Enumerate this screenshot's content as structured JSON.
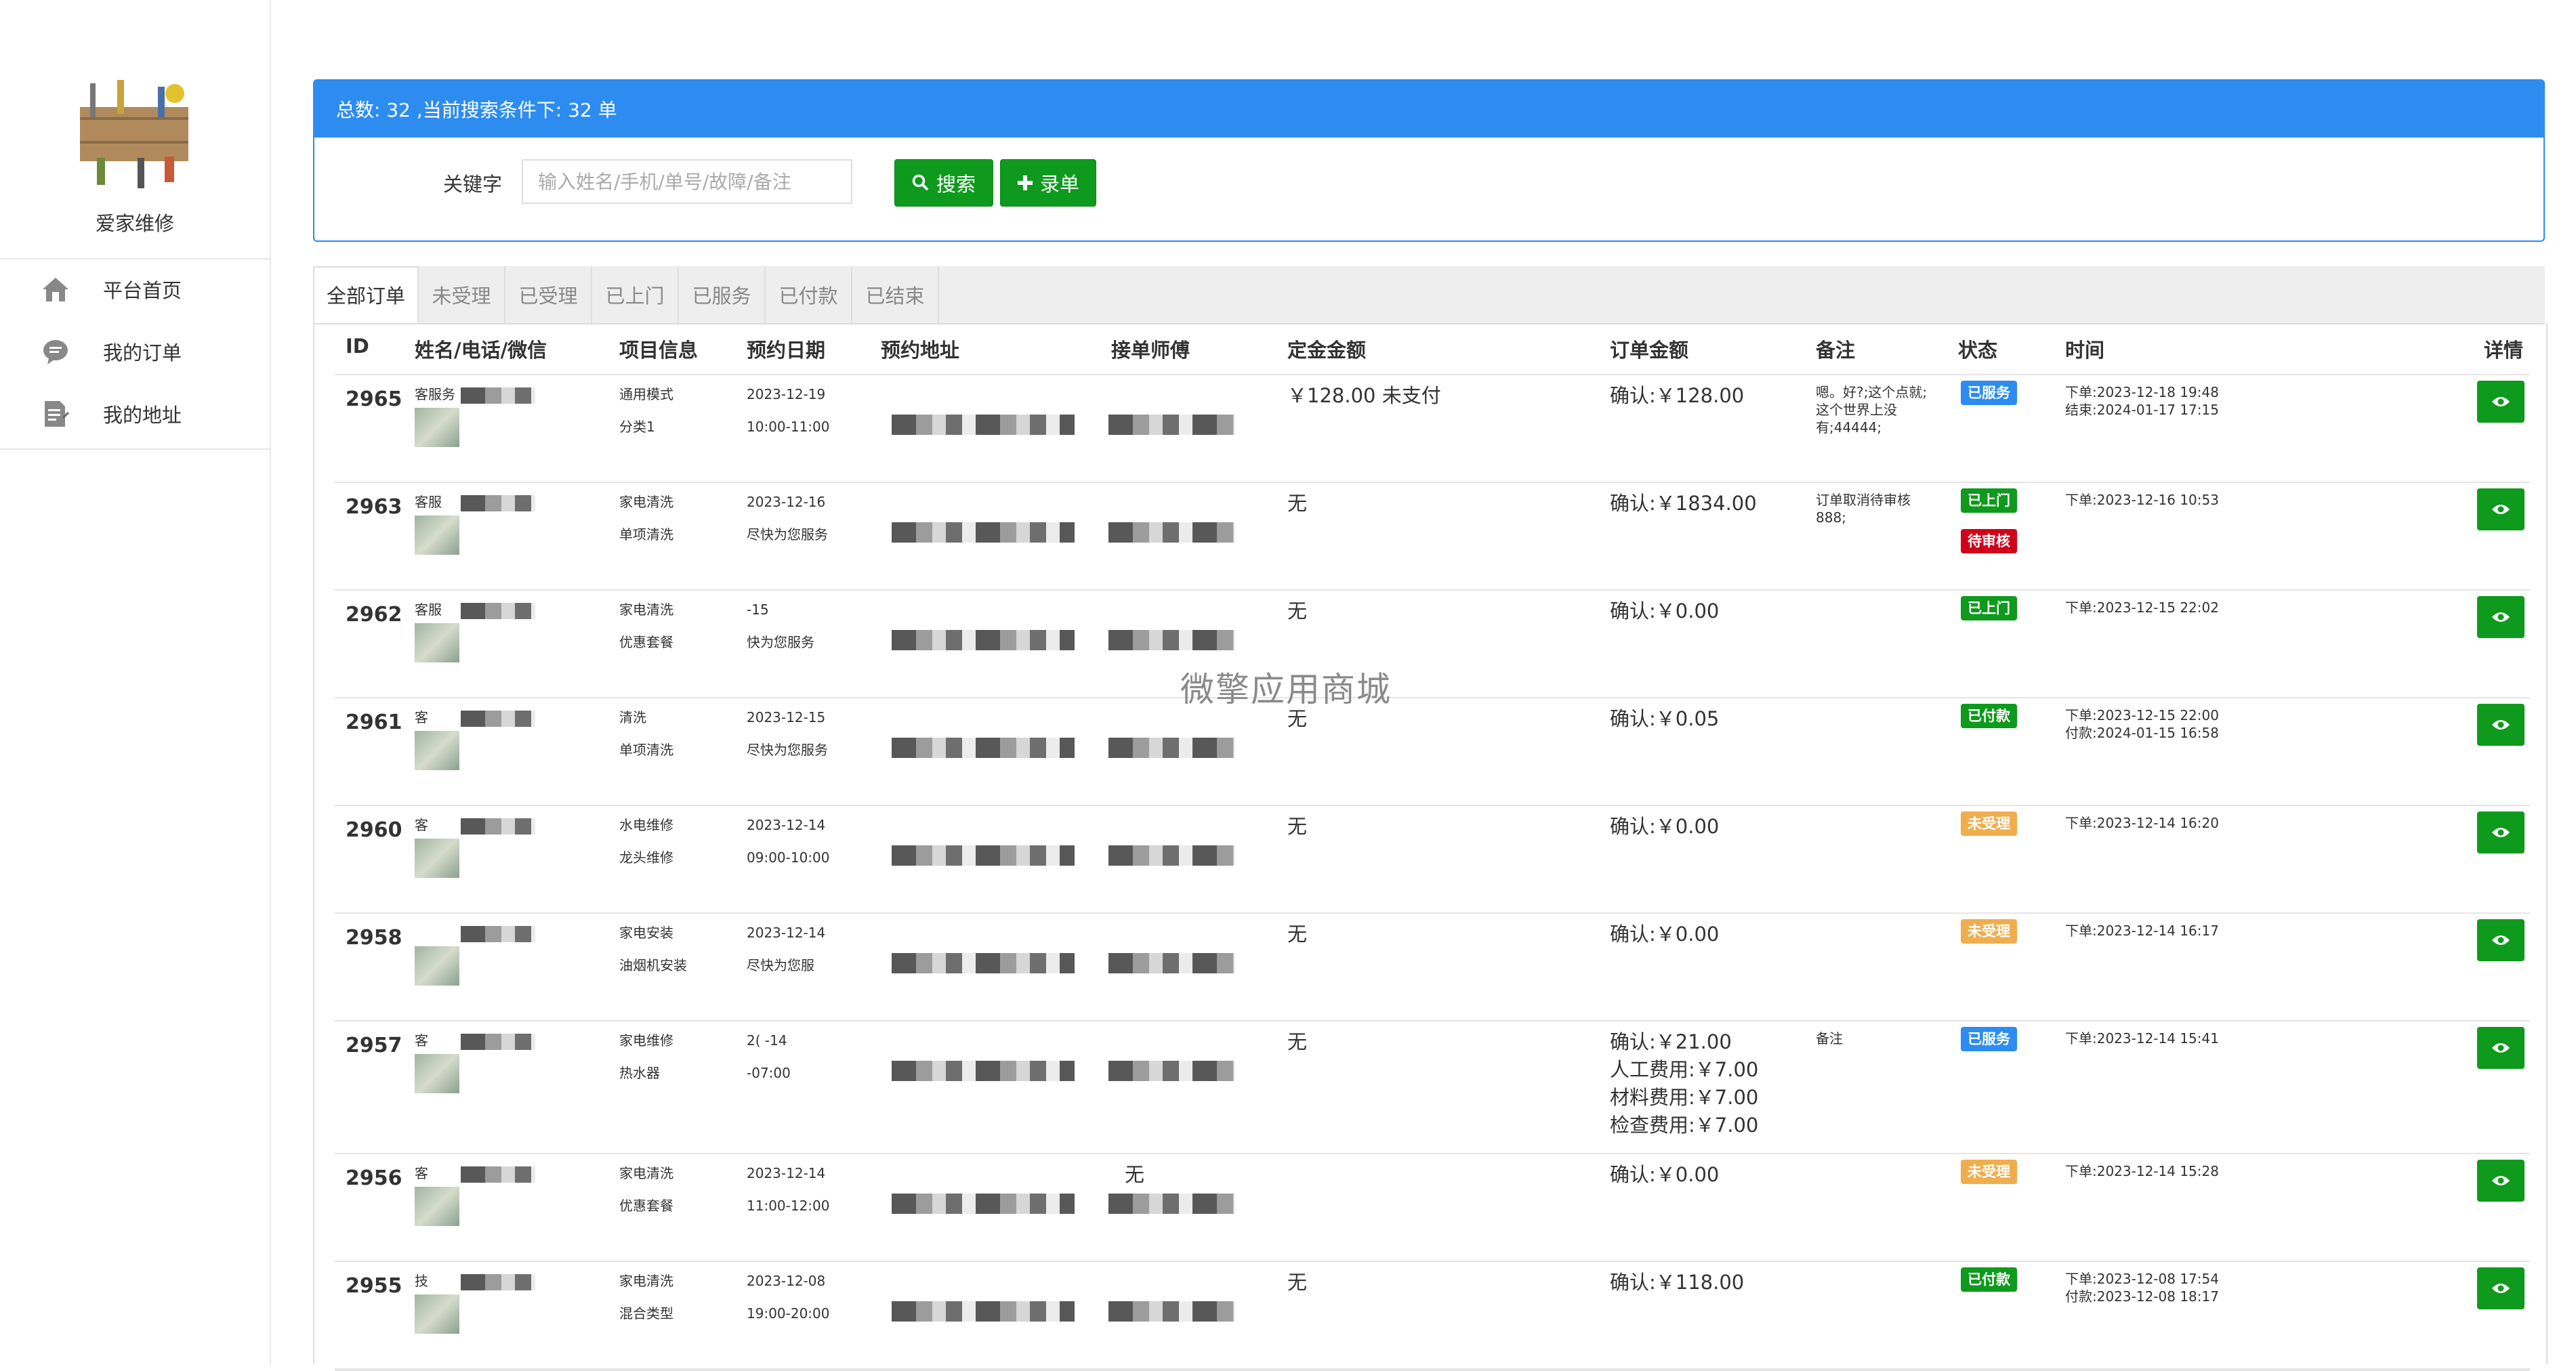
{
  "sidebar": {
    "brand": "爱家维修",
    "items": [
      {
        "label": "平台首页",
        "icon": "home-icon"
      },
      {
        "label": "我的订单",
        "icon": "chat-bubble-icon"
      },
      {
        "label": "我的地址",
        "icon": "document-edit-icon"
      }
    ]
  },
  "panel": {
    "summary": "总数: 32 ,当前搜索条件下: 32 单",
    "keyword_label": "关键字",
    "search_placeholder": "输入姓名/手机/单号/故障/备注",
    "search_value": "",
    "search_button": "搜索",
    "add_button": "录单"
  },
  "tabs": [
    "全部订单",
    "未受理",
    "已受理",
    "已上门",
    "已服务",
    "已付款",
    "已结束"
  ],
  "active_tab": "全部订单",
  "table": {
    "headers": [
      "ID",
      "姓名/电话/微信",
      "项目信息",
      "预约日期",
      "预约地址",
      "接单师傅",
      "定金金额",
      "订单金额",
      "备注",
      "状态",
      "时间",
      "详情"
    ],
    "rows": [
      {
        "id": "2965",
        "name": "客服务",
        "project1": "通用模式",
        "project2": "分类1",
        "date1": "2023-12-19",
        "date2": "10:00-11:00",
        "deposit": "￥128.00 未支付",
        "amounts": [
          "确认:￥128.00"
        ],
        "note": "嗯。好?;这个点就;这个世界上没有;44444;",
        "status": [
          {
            "text": "已服务",
            "color": "#2d8cf0"
          }
        ],
        "time1": "下单:2023-12-18 19:48",
        "time2": "结束:2024-01-17 17:15"
      },
      {
        "id": "2963",
        "name": "客服",
        "project1": "家电清洗",
        "project2": "单项清洗",
        "date1": "2023-12-16",
        "date2": "尽快为您服务",
        "deposit": "无",
        "amounts": [
          "确认:￥1834.00"
        ],
        "note": "订单取消待审核888;",
        "status": [
          {
            "text": "已上门",
            "color": "#0e9a1c"
          },
          {
            "text": "待审核",
            "color": "#d0021b"
          }
        ],
        "time1": "下单:2023-12-16 10:53",
        "time2": ""
      },
      {
        "id": "2962",
        "name": "客服",
        "project1": "家电清洗",
        "project2": "优惠套餐",
        "date1": "-15",
        "date2": "快为您服务",
        "deposit": "无",
        "amounts": [
          "确认:￥0.00"
        ],
        "note": "",
        "status": [
          {
            "text": "已上门",
            "color": "#0e9a1c"
          }
        ],
        "time1": "下单:2023-12-15 22:02",
        "time2": ""
      },
      {
        "id": "2961",
        "name": "客",
        "project1": "清洗",
        "project2": "单项清洗",
        "date1": "2023-12-15",
        "date2": "尽快为您服务",
        "deposit": "无",
        "amounts": [
          "确认:￥0.05"
        ],
        "note": "",
        "status": [
          {
            "text": "已付款",
            "color": "#0e9a1c"
          }
        ],
        "time1": "下单:2023-12-15 22:00",
        "time2": "付款:2024-01-15 16:58"
      },
      {
        "id": "2960",
        "name": "客",
        "project1": "水电维修",
        "project2": "龙头维修",
        "date1": "2023-12-14",
        "date2": "09:00-10:00",
        "deposit": "无",
        "amounts": [
          "确认:￥0.00"
        ],
        "note": "",
        "status": [
          {
            "text": "未受理",
            "color": "#f0ad4e"
          }
        ],
        "time1": "下单:2023-12-14 16:20",
        "time2": ""
      },
      {
        "id": "2958",
        "name": "",
        "project1": "家电安装",
        "project2": "油烟机安装",
        "date1": "2023-12-14",
        "date2": "尽快为您服",
        "deposit": "无",
        "amounts": [
          "确认:￥0.00"
        ],
        "note": "",
        "status": [
          {
            "text": "未受理",
            "color": "#f0ad4e"
          }
        ],
        "time1": "下单:2023-12-14 16:17",
        "time2": ""
      },
      {
        "id": "2957",
        "name": "客",
        "project1": "家电维修",
        "project2": "热水器",
        "date1": "2(    -14",
        "date2": "-07:00",
        "deposit": "无",
        "amounts": [
          "确认:￥21.00",
          "人工费用:￥7.00",
          "材料费用:￥7.00",
          "检查费用:￥7.00"
        ],
        "note": "备注",
        "status": [
          {
            "text": "已服务",
            "color": "#2d8cf0"
          }
        ],
        "time1": "下单:2023-12-14 15:41",
        "time2": ""
      },
      {
        "id": "2956",
        "name": "客",
        "project1": "家电清洗",
        "project2": "优惠套餐",
        "date1": "2023-12-14",
        "date2": "11:00-12:00",
        "deposit": "",
        "amounts": [
          "确认:￥0.00"
        ],
        "note": "",
        "status": [
          {
            "text": "未受理",
            "color": "#f0ad4e"
          }
        ],
        "time1": "下单:2023-12-14 15:28",
        "time2": "",
        "master": "无"
      },
      {
        "id": "2955",
        "name": "技",
        "project1": "家电清洗",
        "project2": "混合类型",
        "date1": "2023-12-08",
        "date2": "19:00-20:00",
        "deposit": "无",
        "amounts": [
          "确认:￥118.00"
        ],
        "note": "",
        "status": [
          {
            "text": "已付款",
            "color": "#0e9a1c"
          }
        ],
        "time1": "下单:2023-12-08 17:54",
        "time2": "付款:2023-12-08 18:17"
      }
    ]
  },
  "watermark": "微擎应用商城"
}
